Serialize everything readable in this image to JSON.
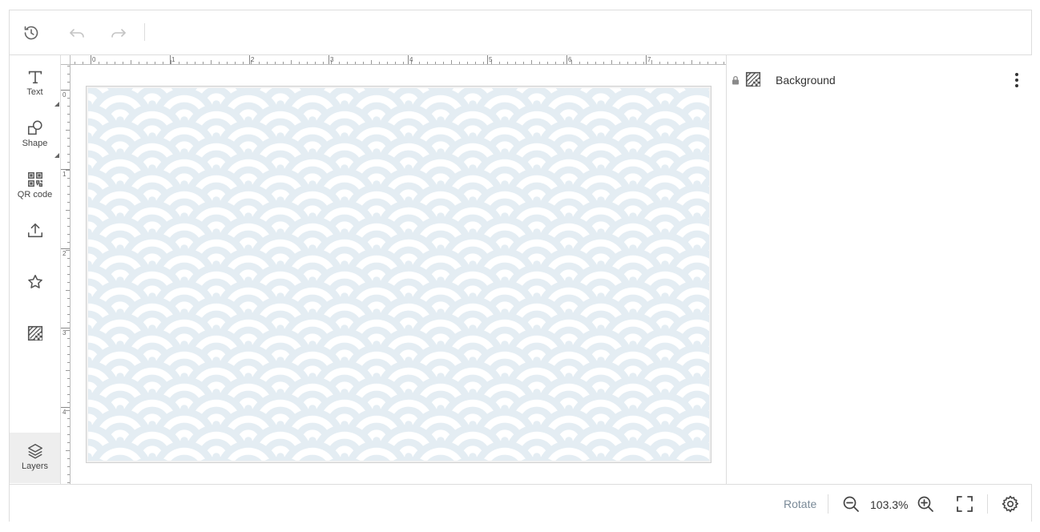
{
  "toolbar": {
    "history_icon": "history-icon",
    "undo_icon": "undo-icon",
    "redo_icon": "redo-icon"
  },
  "tools": [
    {
      "label": "Text",
      "icon": "text-icon"
    },
    {
      "label": "Shape",
      "icon": "shape-icon"
    },
    {
      "label": "QR code",
      "icon": "qr-code-icon"
    },
    {
      "label": "",
      "icon": "upload-icon"
    },
    {
      "label": "",
      "icon": "star-icon"
    },
    {
      "label": "",
      "icon": "background-icon"
    }
  ],
  "layers_tab": {
    "label": "Layers",
    "icon": "layers-icon"
  },
  "ruler": {
    "h_labels": [
      "0",
      "1",
      "2",
      "3",
      "4",
      "5",
      "6",
      "7"
    ],
    "v_labels": [
      "0",
      "1",
      "2",
      "3",
      "4"
    ]
  },
  "layers": [
    {
      "name": "Background",
      "locked": true,
      "icon": "background-icon"
    }
  ],
  "bottombar": {
    "rotate_label": "Rotate",
    "zoom_value": "103.3%"
  },
  "colors": {
    "pattern_bg": "#e4edf3",
    "pattern_arc": "#ffffff",
    "icon": "#555555",
    "disabled_icon": "#c4c4c4"
  }
}
